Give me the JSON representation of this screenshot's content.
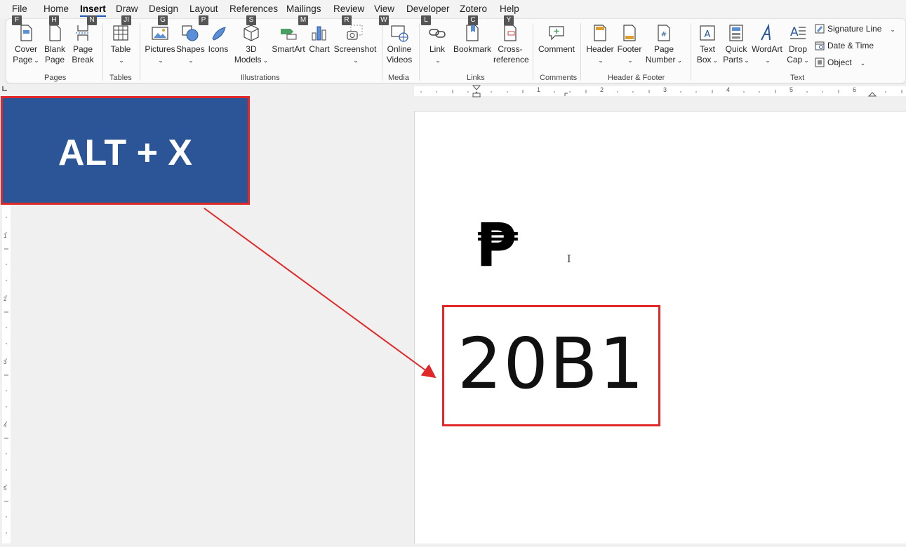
{
  "menu": {
    "items": [
      "File",
      "Home",
      "Insert",
      "Draw",
      "Design",
      "Layout",
      "References",
      "Mailings",
      "Review",
      "View",
      "Developer",
      "Zotero",
      "Help"
    ],
    "keytips": [
      "F",
      "H",
      "N",
      "JI",
      "G",
      "P",
      "S",
      "M",
      "R",
      "W",
      "L",
      "C",
      "Y"
    ]
  },
  "ribbon": {
    "pages": {
      "cover1": "Cover",
      "cover2": "Page",
      "blank1": "Blank",
      "blank2": "Page",
      "break1": "Page",
      "break2": "Break",
      "label": "Pages"
    },
    "tables": {
      "table": "Table",
      "label": "Tables"
    },
    "illustrations": {
      "pictures": "Pictures",
      "shapes": "Shapes",
      "icons": "Icons",
      "models1": "3D",
      "models2": "Models",
      "smartart": "SmartArt",
      "chart": "Chart",
      "screenshot": "Screenshot",
      "label": "Illustrations"
    },
    "media": {
      "online1": "Online",
      "online2": "Videos",
      "label": "Media"
    },
    "links": {
      "link": "Link",
      "bookmark": "Bookmark",
      "cross1": "Cross-",
      "cross2": "reference",
      "label": "Links"
    },
    "comments": {
      "comment": "Comment",
      "label": "Comments"
    },
    "headerfooter": {
      "header": "Header",
      "footer": "Footer",
      "pagenum1": "Page",
      "pagenum2": "Number",
      "label": "Header & Footer"
    },
    "text": {
      "textbox1": "Text",
      "textbox2": "Box",
      "quick1": "Quick",
      "quick2": "Parts",
      "wordart": "WordArt",
      "drop1": "Drop",
      "drop2": "Cap",
      "signature": "Signature Line",
      "datetime": "Date & Time",
      "object": "Object",
      "label": "Text"
    }
  },
  "ruler": {
    "numbers": [
      "1",
      "2",
      "3",
      "4",
      "5",
      "6"
    ],
    "vnumbers": [
      "1",
      "2",
      "3",
      "4",
      "5"
    ]
  },
  "document": {
    "symbol": "₱",
    "code": "20B1"
  },
  "callout": {
    "shortcut": "ALT + X"
  },
  "colors": {
    "accent": "#185abd",
    "callout_bg": "#2b5596",
    "highlight": "#e02828"
  }
}
